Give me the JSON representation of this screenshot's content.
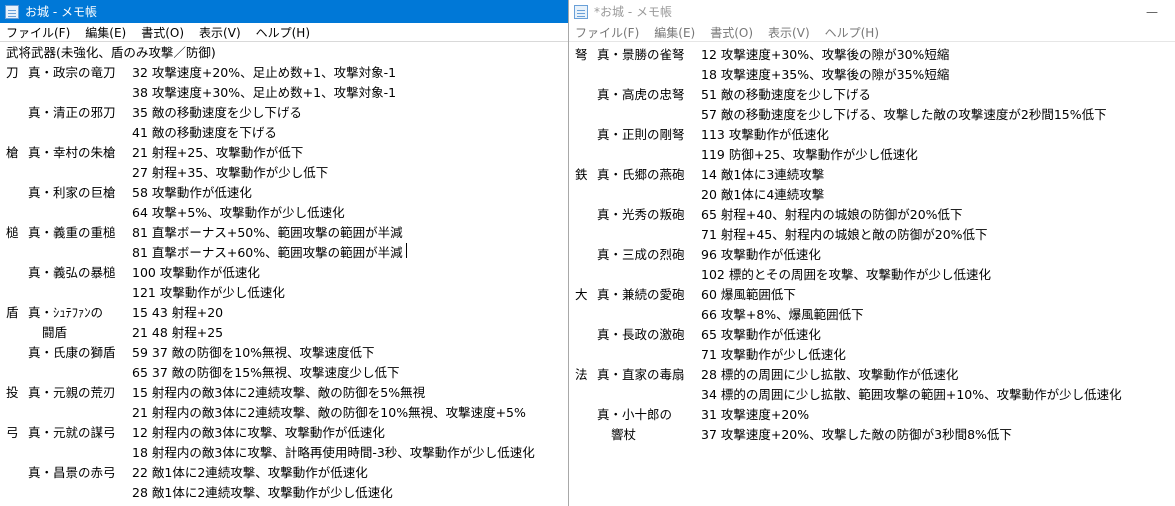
{
  "left": {
    "title": "お城 - メモ帳",
    "menu": [
      "ファイル(F)",
      "編集(E)",
      "書式(O)",
      "表示(V)",
      "ヘルプ(H)"
    ],
    "header": "武将武器(未強化、盾のみ攻撃／防御)",
    "rows": [
      {
        "k": "刀",
        "n": "真・政宗の竜刀",
        "t": "32 攻撃速度+20%、足止め数+1、攻撃対象-1"
      },
      {
        "k": "",
        "n": "",
        "t": "38 攻撃速度+30%、足止め数+1、攻撃対象-1"
      },
      {
        "k": "",
        "n": "真・清正の邪刀",
        "t": "35 敵の移動速度を少し下げる"
      },
      {
        "k": "",
        "n": "",
        "t": "41 敵の移動速度を下げる"
      },
      {
        "k": "槍",
        "n": "真・幸村の朱槍",
        "t": "21 射程+25、攻撃動作が低下"
      },
      {
        "k": "",
        "n": "",
        "t": "27 射程+35、攻撃動作が少し低下"
      },
      {
        "k": "",
        "n": "真・利家の巨槍",
        "t": "58 攻撃動作が低速化"
      },
      {
        "k": "",
        "n": "",
        "t": "64 攻撃+5%、攻撃動作が少し低速化"
      },
      {
        "k": "槌",
        "n": "真・義重の重槌",
        "t": "81 直撃ボーナス+50%、範囲攻撃の範囲が半減"
      },
      {
        "k": "",
        "n": "",
        "t": "81 直撃ボーナス+60%、範囲攻撃の範囲が半減",
        "caret": true
      },
      {
        "k": "",
        "n": "真・義弘の暴槌",
        "t": "100 攻撃動作が低速化"
      },
      {
        "k": "",
        "n": "",
        "t": "121 攻撃動作が少し低速化"
      },
      {
        "k": "盾",
        "n": "真・ｼｭﾃﾌｧﾝの",
        "t": "15 43 射程+20"
      },
      {
        "k": "",
        "n": "闘盾",
        "indent": true,
        "t": "21 48 射程+25"
      },
      {
        "k": "",
        "n": "真・氏康の獅盾",
        "t": "59 37 敵の防御を10%無視、攻撃速度低下"
      },
      {
        "k": "",
        "n": "",
        "t": "65 37 敵の防御を15%無視、攻撃速度少し低下"
      },
      {
        "k": "投",
        "n": "真・元親の荒刃",
        "t": "15 射程内の敵3体に2連続攻撃、敵の防御を5%無視"
      },
      {
        "k": "",
        "n": "",
        "t": "21 射程内の敵3体に2連続攻撃、敵の防御を10%無視、攻撃速度+5%"
      },
      {
        "k": "弓",
        "n": "真・元就の謀弓",
        "t": "12 射程内の敵3体に攻撃、攻撃動作が低速化"
      },
      {
        "k": "",
        "n": "",
        "t": "18 射程内の敵3体に攻撃、計略再使用時間-3秒、攻撃動作が少し低速化"
      },
      {
        "k": "",
        "n": "真・昌景の赤弓",
        "t": "22 敵1体に2連続攻撃、攻撃動作が低速化"
      },
      {
        "k": "",
        "n": "",
        "t": "28 敵1体に2連続攻撃、攻撃動作が少し低速化"
      }
    ]
  },
  "right": {
    "title": "*お城 - メモ帳",
    "menu": [
      "ファイル(F)",
      "編集(E)",
      "書式(O)",
      "表示(V)",
      "ヘルプ(H)"
    ],
    "rows": [
      {
        "k": "弩",
        "n": "真・景勝の雀弩",
        "t": "12 攻撃速度+30%、攻撃後の隙が30%短縮"
      },
      {
        "k": "",
        "n": "",
        "t": "18 攻撃速度+35%、攻撃後の隙が35%短縮"
      },
      {
        "k": "",
        "n": "真・高虎の忠弩",
        "t": "51 敵の移動速度を少し下げる"
      },
      {
        "k": "",
        "n": "",
        "t": "57 敵の移動速度を少し下げる、攻撃した敵の攻撃速度が2秒間15%低下"
      },
      {
        "k": "",
        "n": "真・正則の剛弩",
        "t": "113 攻撃動作が低速化"
      },
      {
        "k": "",
        "n": "",
        "t": "119 防御+25、攻撃動作が少し低速化"
      },
      {
        "k": "鉄",
        "n": "真・氏郷の燕砲",
        "t": "14 敵1体に3連続攻撃"
      },
      {
        "k": "",
        "n": "",
        "t": "20 敵1体に4連続攻撃"
      },
      {
        "k": "",
        "n": "真・光秀の叛砲",
        "t": "65 射程+40、射程内の城娘の防御が20%低下"
      },
      {
        "k": "",
        "n": "",
        "t": "71 射程+45、射程内の城娘と敵の防御が20%低下"
      },
      {
        "k": "",
        "n": "真・三成の烈砲",
        "t": "96 攻撃動作が低速化"
      },
      {
        "k": "",
        "n": "",
        "t": "102 標的とその周囲を攻撃、攻撃動作が少し低速化"
      },
      {
        "k": "大",
        "n": "真・兼続の愛砲",
        "t": "60 爆風範囲低下"
      },
      {
        "k": "",
        "n": "",
        "t": "66 攻撃+8%、爆風範囲低下"
      },
      {
        "k": "",
        "n": "真・長政の激砲",
        "t": "65 攻撃動作が低速化"
      },
      {
        "k": "",
        "n": "",
        "t": "71 攻撃動作が少し低速化"
      },
      {
        "k": "法",
        "n": "真・直家の毒扇",
        "t": "28 標的の周囲に少し拡散、攻撃動作が低速化"
      },
      {
        "k": "",
        "n": "",
        "t": "34 標的の周囲に少し拡散、範囲攻撃の範囲+10%、攻撃動作が少し低速化"
      },
      {
        "k": "",
        "n": "真・小十郎の",
        "t": "31 攻撃速度+20%"
      },
      {
        "k": "",
        "n": "響杖",
        "indent": true,
        "t": "37 攻撃速度+20%、攻撃した敵の防御が3秒間8%低下"
      }
    ]
  },
  "colors": {
    "active_titlebar": "#0078d7",
    "inactive_title_text": "#9a9a9a"
  }
}
